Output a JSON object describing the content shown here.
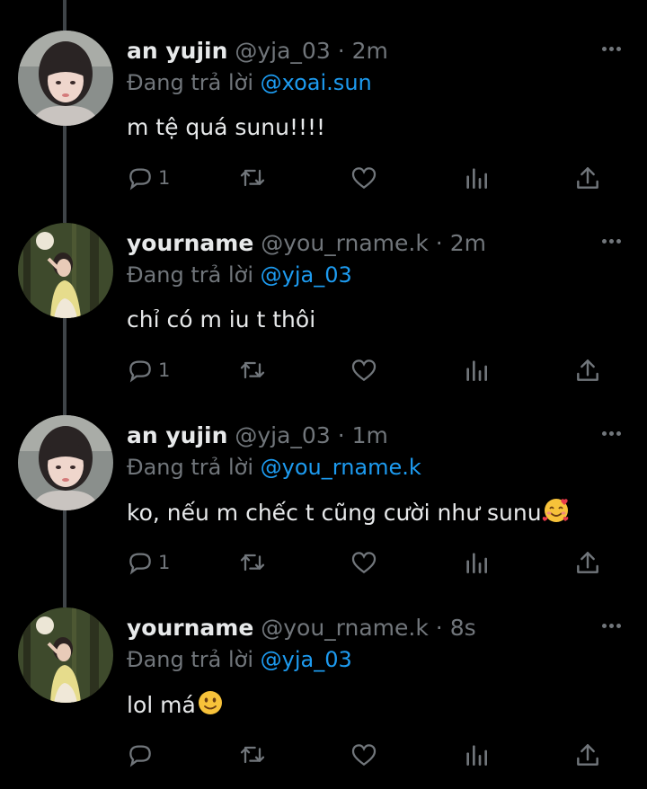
{
  "colors": {
    "background": "#000000",
    "text_primary": "#e7e9ea",
    "text_secondary": "#71767b",
    "link_blue": "#1d9bf0",
    "thread_line": "#3f4448"
  },
  "tweets": [
    {
      "name": "an yujin",
      "handle": "@yja_03",
      "dot": "·",
      "time": "2m",
      "reply_label": "Đang trả lời",
      "reply_to": "@xoai.sun",
      "text": "m tệ quá sunu!!!!",
      "reply_count": "1",
      "avatar": "avatar-girl-bangs",
      "emoji": ""
    },
    {
      "name": "yourname",
      "handle": "@you_rname.k",
      "dot": "·",
      "time": "2m",
      "reply_label": "Đang trả lời",
      "reply_to": "@yja_03",
      "text": "chỉ có m iu t thôi",
      "reply_count": "1",
      "avatar": "avatar-girl-forest",
      "emoji": ""
    },
    {
      "name": "an yujin",
      "handle": "@yja_03",
      "dot": "·",
      "time": "1m",
      "reply_label": "Đang trả lời",
      "reply_to": "@you_rname.k",
      "text": "ko, nếu m chếc t cũng cười như sunu",
      "reply_count": "1",
      "avatar": "avatar-girl-bangs",
      "emoji": "smiling-face-with-hearts-emoji"
    },
    {
      "name": "yourname",
      "handle": "@you_rname.k",
      "dot": "·",
      "time": "8s",
      "reply_label": "Đang trả lời",
      "reply_to": "@yja_03",
      "text": "lol má",
      "reply_count": "",
      "avatar": "avatar-girl-forest",
      "emoji": "slightly-smiling-face-emoji"
    }
  ],
  "icons": {
    "reply": "reply-icon",
    "retweet": "retweet-icon",
    "like": "heart-icon",
    "views": "views-chart-icon",
    "share": "share-icon",
    "more": "more-options-icon"
  }
}
